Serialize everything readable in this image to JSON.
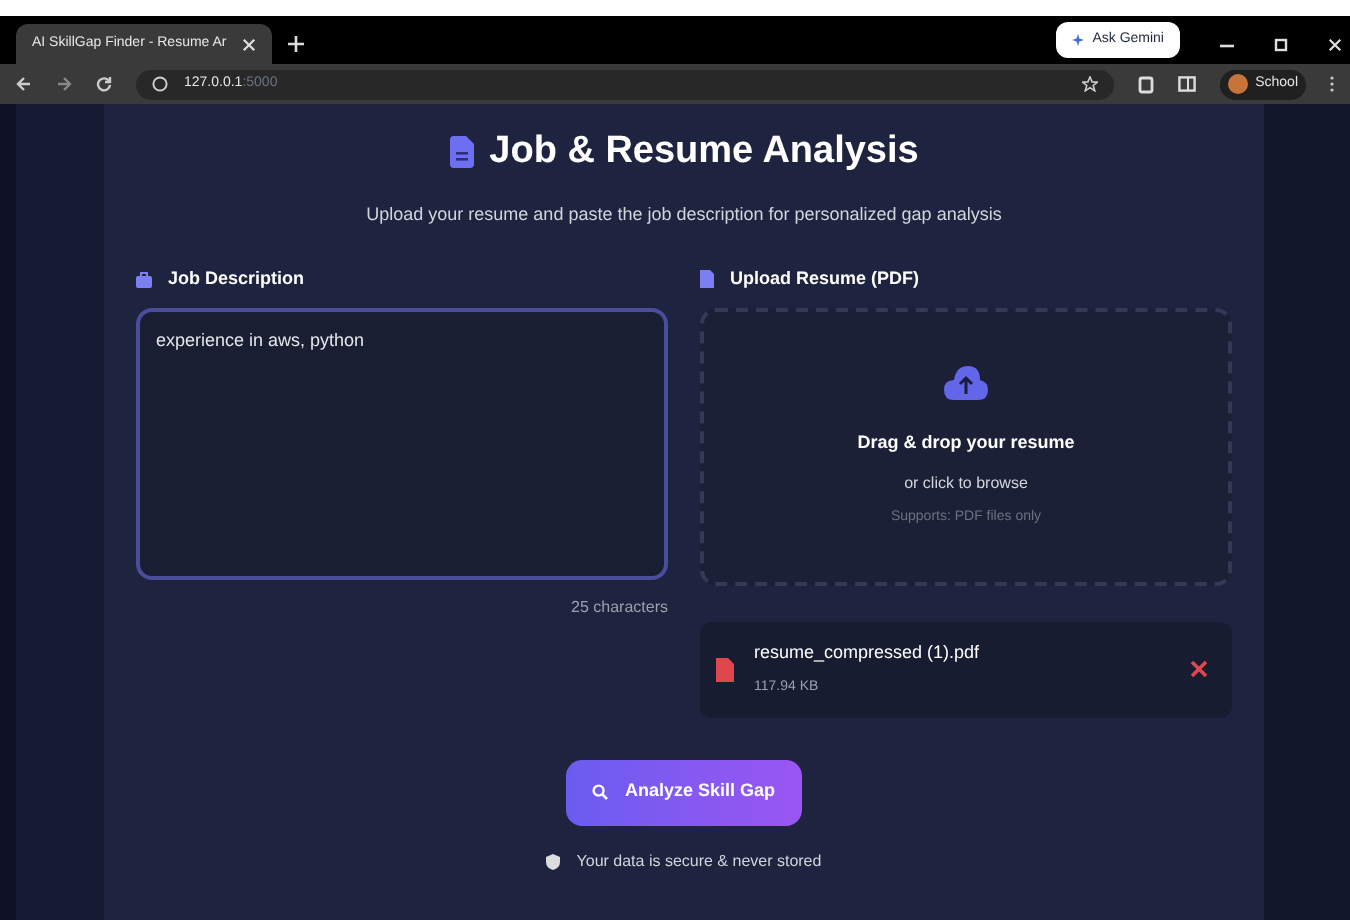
{
  "browser": {
    "tab_title": "AI SkillGap Finder - Resume Ar",
    "ask_gemini": "Ask Gemini",
    "url_host": "127.0.0.1",
    "url_port": ":5000",
    "profile": "School"
  },
  "page": {
    "title": "Job & Resume Analysis",
    "subtitle": "Upload your resume and paste the job description for personalized gap analysis",
    "job": {
      "label": "Job Description",
      "value": "experience in aws, python",
      "count": "25 characters"
    },
    "upload": {
      "label": "Upload Resume (PDF)",
      "headline": "Drag & drop your resume",
      "browse": "or click to browse",
      "hint": "Supports: PDF files only"
    },
    "file": {
      "name": "resume_compressed (1).pdf",
      "size": "117.94 KB"
    },
    "button": "Analyze Skill Gap",
    "note": "Your data is secure & never stored"
  }
}
